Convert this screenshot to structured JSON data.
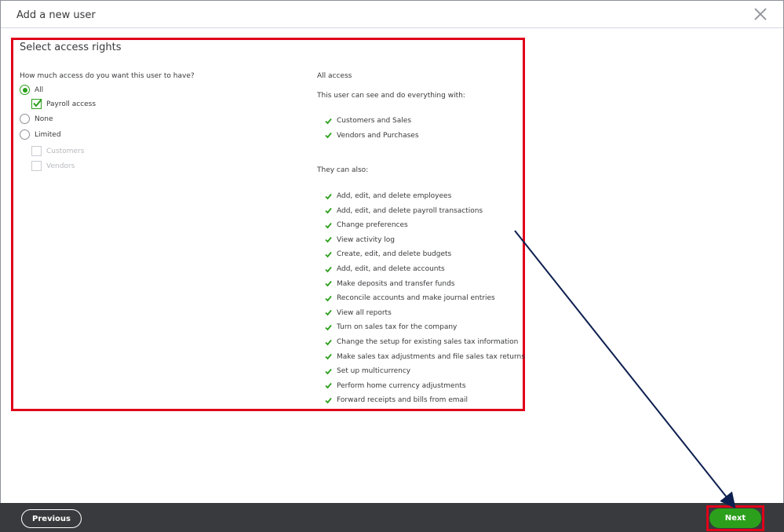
{
  "dialog": {
    "title": "Add a new user",
    "close_icon": "close-icon"
  },
  "section": {
    "title": "Select access rights",
    "question": "How much access do you want this user to have?",
    "options": [
      {
        "label": "All",
        "selected": true
      },
      {
        "label": "None",
        "selected": false
      },
      {
        "label": "Limited",
        "selected": false
      }
    ],
    "all_sub": [
      {
        "label": "Payroll access",
        "checked": true,
        "disabled": false
      }
    ],
    "limited_sub": [
      {
        "label": "Customers",
        "checked": false,
        "disabled": true
      },
      {
        "label": "Vendors",
        "checked": false,
        "disabled": true
      }
    ]
  },
  "details": {
    "title": "All access",
    "description": "This user can see and do everything with:",
    "areas": [
      "Customers and Sales",
      "Vendors and Purchases"
    ],
    "also_title": "They can also:",
    "also": [
      "Add, edit, and delete employees",
      "Add, edit, and delete payroll transactions",
      "Change preferences",
      "View activity log",
      "Create, edit, and delete budgets",
      "Add, edit, and delete accounts",
      "Make deposits and transfer funds",
      "Reconcile accounts and make journal entries",
      "View all reports",
      "Turn on sales tax for the company",
      "Change the setup for existing sales tax information",
      "Make sales tax adjustments and file sales tax returns",
      "Set up multicurrency",
      "Perform home currency adjustments",
      "Forward receipts and bills from email"
    ],
    "check_icon": "check-icon"
  },
  "footer": {
    "previous_label": "Previous",
    "next_label": "Next"
  },
  "colors": {
    "accent_green": "#2ca01c",
    "annotation_red": "#e0001a",
    "annotation_arrow": "#0d1f4f",
    "footer_bg": "#393a3d"
  }
}
